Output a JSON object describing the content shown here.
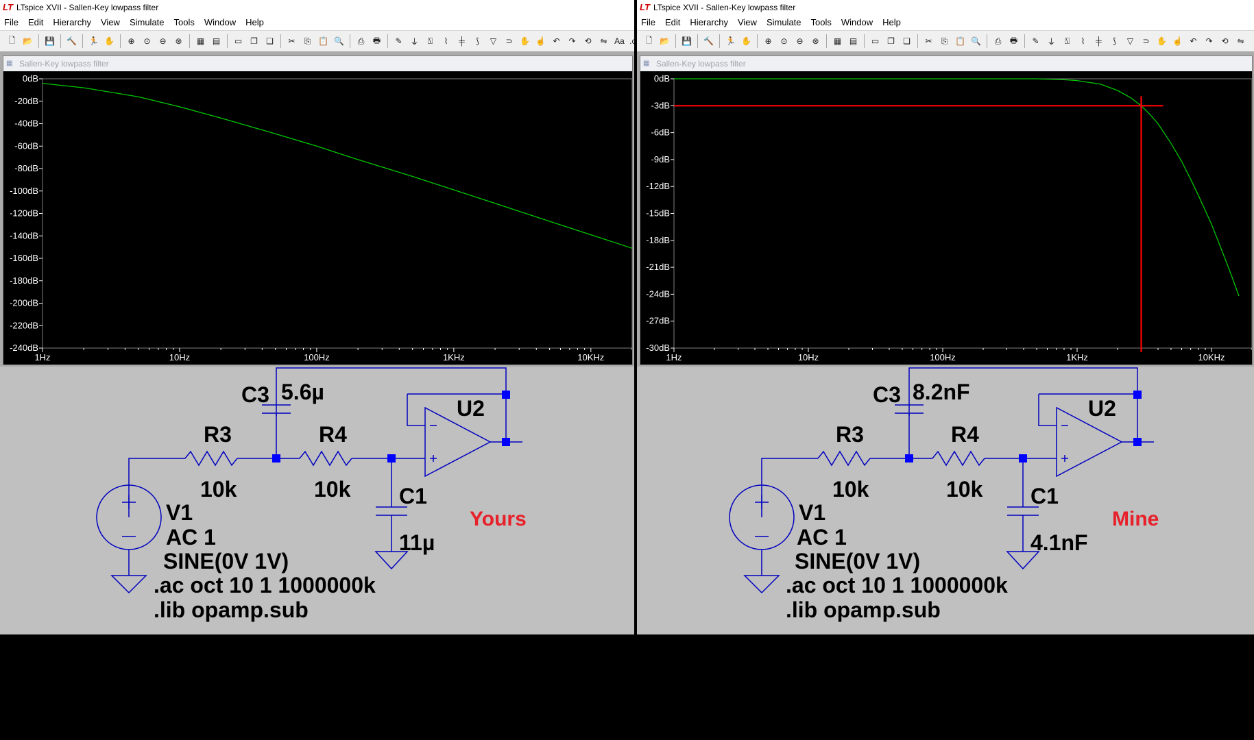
{
  "left": {
    "title": "LTspice XVII - Sallen-Key lowpass filter",
    "plot_title": "Sallen-Key lowpass filter",
    "schematic": {
      "c3_name": "C3",
      "c3_value": "5.6µ",
      "r3_name": "R3",
      "r3_value": "10k",
      "r4_name": "R4",
      "r4_value": "10k",
      "c1_name": "C1",
      "c1_value": "11µ",
      "u2_name": "U2",
      "v1_name": "V1",
      "v1_ac": "AC 1",
      "v1_sine": "SINE(0V 1V)",
      "ac_directive": ".ac oct 10 1 1000000k",
      "lib_directive": ".lib opamp.sub",
      "annotation": "Yours"
    }
  },
  "right": {
    "title": "LTspice XVII - Sallen-Key lowpass filter",
    "plot_title": "Sallen-Key lowpass filter",
    "schematic": {
      "c3_name": "C3",
      "c3_value": "8.2nF",
      "r3_name": "R3",
      "r3_value": "10k",
      "r4_name": "R4",
      "r4_value": "10k",
      "c1_name": "C1",
      "c1_value": "4.1nF",
      "u2_name": "U2",
      "v1_name": "V1",
      "v1_ac": "AC 1",
      "v1_sine": "SINE(0V 1V)",
      "ac_directive": ".ac oct 10 1 1000000k",
      "lib_directive": ".lib opamp.sub",
      "annotation": "Mine"
    }
  },
  "menu": [
    "File",
    "Edit",
    "Hierarchy",
    "View",
    "Simulate",
    "Tools",
    "Window",
    "Help"
  ],
  "colors": {
    "trace": "#00c800",
    "cursor": "#ff0000",
    "wire": "#0000c0",
    "node": "#0000ff",
    "annotation": "#e8202a"
  },
  "chart_data": [
    {
      "type": "line",
      "x_scale": "log",
      "xlim": [
        1,
        20000
      ],
      "ylim": [
        -240,
        0
      ],
      "x_ticks": [
        "1Hz",
        "10Hz",
        "100Hz",
        "1KHz",
        "10KHz"
      ],
      "y_ticks": [
        "0dB",
        "-20dB",
        "-40dB",
        "-60dB",
        "-80dB",
        "-100dB",
        "-120dB",
        "-140dB",
        "-160dB",
        "-180dB",
        "-200dB",
        "-220dB",
        "-240dB"
      ],
      "series": [
        {
          "x": [
            1,
            2,
            5,
            10,
            20,
            50,
            100,
            200,
            500,
            1000,
            2000,
            5000,
            10000,
            20000
          ],
          "y": [
            -4,
            -8,
            -16,
            -25,
            -35,
            -49,
            -60,
            -72,
            -87,
            -99,
            -111,
            -127,
            -139,
            -151
          ]
        }
      ]
    },
    {
      "type": "line",
      "x_scale": "log",
      "xlim": [
        1,
        20000
      ],
      "ylim": [
        -30,
        0
      ],
      "x_ticks": [
        "1Hz",
        "10Hz",
        "100Hz",
        "1KHz",
        "10KHz"
      ],
      "y_ticks": [
        "0dB",
        "-3dB",
        "-6dB",
        "-9dB",
        "-12dB",
        "-15dB",
        "-18dB",
        "-21dB",
        "-24dB",
        "-27dB",
        "-30dB"
      ],
      "series": [
        {
          "x": [
            1,
            10,
            100,
            500,
            800,
            1000,
            1500,
            2000,
            2500,
            3000,
            3500,
            4000,
            5000,
            6000,
            7000,
            8000,
            10000,
            12000,
            14000,
            16000
          ],
          "y": [
            0,
            0,
            0,
            0,
            -0.1,
            -0.2,
            -0.6,
            -1.3,
            -2.1,
            -3.0,
            -4.0,
            -5.0,
            -7.2,
            -9.2,
            -11.2,
            -13.0,
            -16.2,
            -19.2,
            -21.8,
            -24.2
          ]
        }
      ],
      "cursor": {
        "x": 3000,
        "y": -3
      }
    }
  ]
}
